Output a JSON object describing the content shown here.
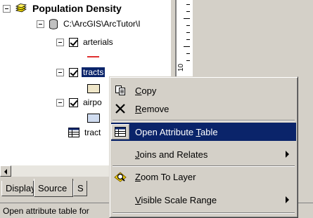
{
  "toc": {
    "data_frame": {
      "label": "Population Density",
      "icon": "layers-icon"
    },
    "database": {
      "label": "C:\\ArcGIS\\ArcTutor\\I",
      "icon": "database-icon"
    },
    "layers": [
      {
        "label": "arterials",
        "symbol_color": "#e03030"
      },
      {
        "label": "tracts",
        "symbol_color": "#efe6c8"
      },
      {
        "label": "airpo",
        "symbol_color": "#d0dcf0"
      }
    ],
    "table": {
      "label": "tract"
    }
  },
  "tabs": {
    "display": "Display",
    "source": "Source",
    "selection": "S"
  },
  "status": {
    "text": "Open attribute table for"
  },
  "ruler": {
    "label": "10"
  },
  "context_menu": {
    "copy": {
      "pre": "",
      "key": "C",
      "post": "opy"
    },
    "remove": {
      "pre": "",
      "key": "R",
      "post": "emove"
    },
    "open_attribute_table": {
      "pre": "Open Attribute ",
      "key": "T",
      "post": "able"
    },
    "joins_relates": {
      "pre": "",
      "key": "J",
      "post": "oins and Relates"
    },
    "zoom_to_layer": {
      "pre": "",
      "key": "Z",
      "post": "oom To Layer"
    },
    "visible_scale_range": {
      "pre": "",
      "key": "V",
      "post": "isible Scale Range"
    }
  },
  "colors": {
    "selection": "#0a246a",
    "face": "#d4d0c8"
  }
}
